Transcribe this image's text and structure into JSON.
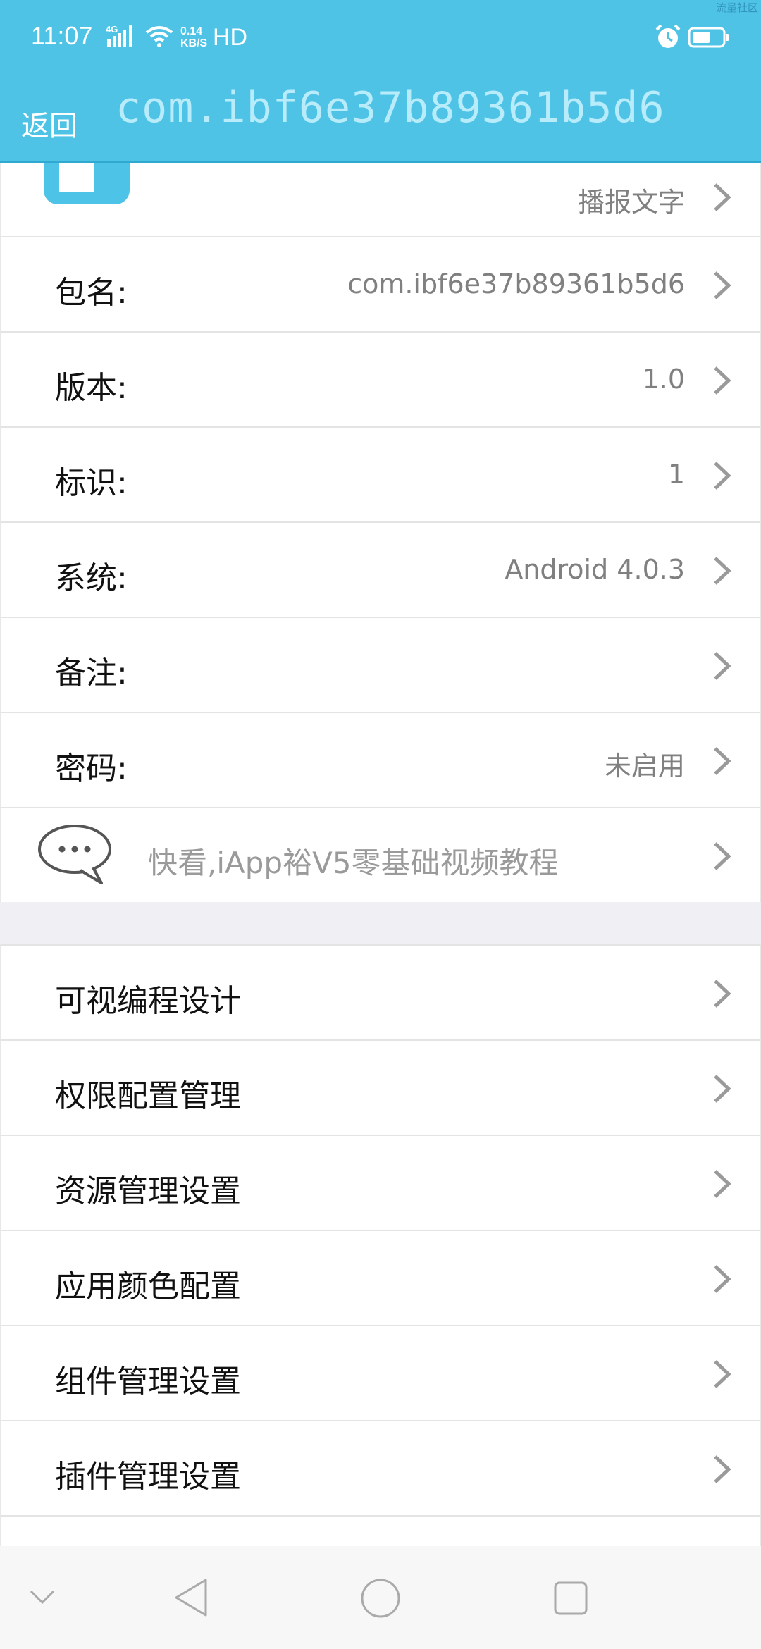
{
  "status_bar": {
    "time": "11:07",
    "network": "4G",
    "speed_value": "0.14",
    "speed_unit": "KB/S",
    "hd": "HD",
    "watermark": "流量社区"
  },
  "header": {
    "back_label": "返回",
    "title": "com.ibf6e37b89361b5d6",
    "bg_color": "#4fc3e6"
  },
  "app_info": {
    "icon": "info-icon",
    "broadcast_text": "播报文字",
    "rows": [
      {
        "label": "包名:",
        "value": "com.ibf6e37b89361b5d6"
      },
      {
        "label": "版本:",
        "value": "1.0"
      },
      {
        "label": "标识:",
        "value": "1"
      },
      {
        "label": "系统:",
        "value": "Android 4.0.3"
      },
      {
        "label": "备注:",
        "value": ""
      },
      {
        "label": "密码:",
        "value": "未启用"
      }
    ],
    "tutorial": "快看,iApp裕V5零基础视频教程"
  },
  "settings_menu": [
    {
      "label": "可视编程设计"
    },
    {
      "label": "权限配置管理"
    },
    {
      "label": "资源管理设置"
    },
    {
      "label": "应用颜色配置"
    },
    {
      "label": "组件管理设置"
    },
    {
      "label": "插件管理设置"
    }
  ],
  "nav": {
    "icons": [
      "chevron-down-icon",
      "back-triangle-icon",
      "home-circle-icon",
      "recents-square-icon"
    ]
  }
}
